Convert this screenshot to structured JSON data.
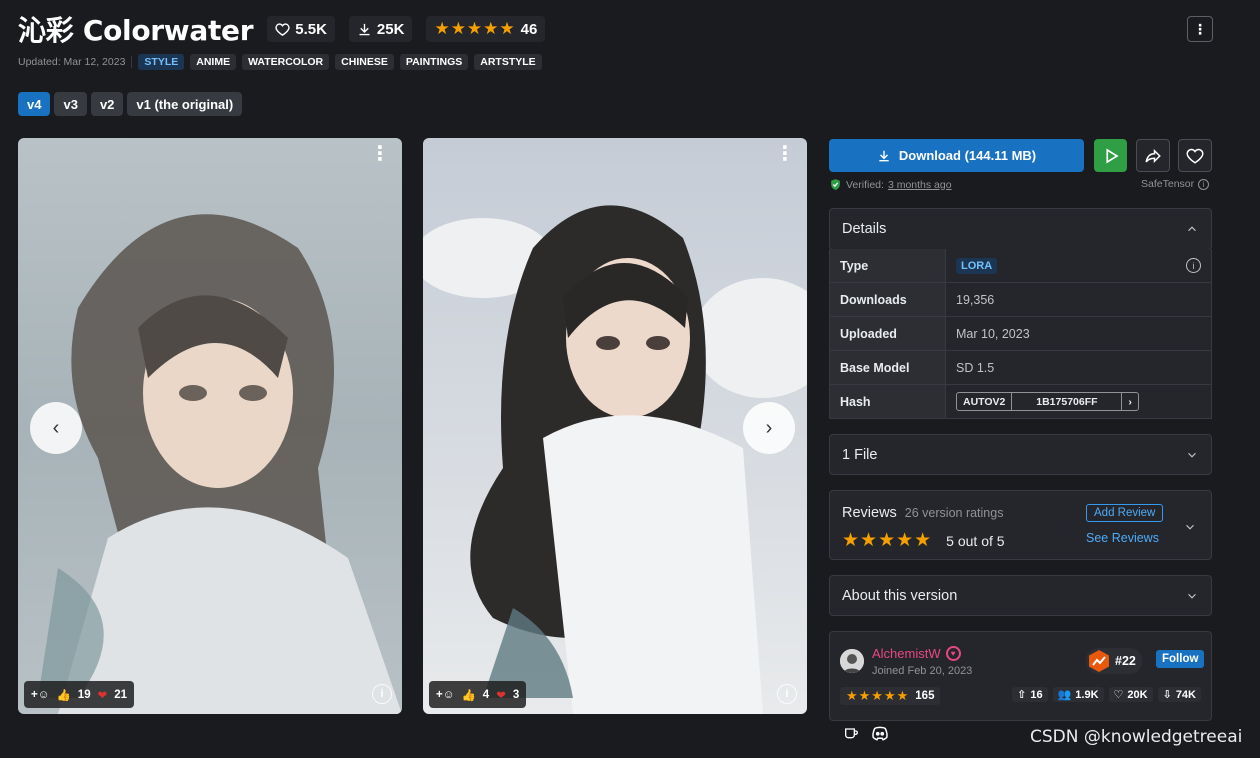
{
  "header": {
    "title": "沁彩 Colorwater",
    "likes": "5.5K",
    "downloads": "25K",
    "stars": "★★★★★",
    "rating_count": "46",
    "more_label": "⋮"
  },
  "meta": {
    "updated": "Updated: Mar 12, 2023",
    "tags": [
      "STYLE",
      "ANIME",
      "WATERCOLOR",
      "CHINESE",
      "PAINTINGS",
      "ARTSTYLE"
    ]
  },
  "versions": [
    "v4",
    "v3",
    "v2",
    "v1 (the original)"
  ],
  "active_version": "v4",
  "gallery": [
    {
      "likes": "19",
      "hearts": "21"
    },
    {
      "likes": "4",
      "hearts": "3"
    }
  ],
  "actions": {
    "download_label": "Download (144.11 MB)",
    "verified_prefix": "Verified:",
    "verified_time": "3 months ago",
    "safetensor": "SafeTensor"
  },
  "details": {
    "title": "Details",
    "rows": {
      "type_key": "Type",
      "type_val": "LORA",
      "downloads_key": "Downloads",
      "downloads_val": "19,356",
      "uploaded_key": "Uploaded",
      "uploaded_val": "Mar 10, 2023",
      "base_key": "Base Model",
      "base_val": "SD 1.5",
      "hash_key": "Hash",
      "hash_algo": "AUTOV2",
      "hash_val": "1B175706FF"
    }
  },
  "files": {
    "title": "1 File"
  },
  "reviews": {
    "title": "Reviews",
    "sub": "26 version ratings",
    "stars": "★★★★★",
    "score": "5 out of 5",
    "add": "Add Review",
    "see": "See Reviews"
  },
  "about": {
    "title": "About this version"
  },
  "creator": {
    "name": "AlchemistW",
    "joined": "Joined Feb 20, 2023",
    "rank": "#22",
    "follow": "Follow",
    "stars": "★★★★★",
    "rating": "165",
    "uploads": "16",
    "followers": "1.9K",
    "favorites": "20K",
    "downloads": "74K"
  },
  "watermark": "CSDN @knowledgetreeai",
  "colors": {
    "accent": "#1971c2",
    "bg": "#1a1b1e",
    "panel": "#25262b",
    "star": "#f59f00",
    "play": "#2f9e44"
  }
}
